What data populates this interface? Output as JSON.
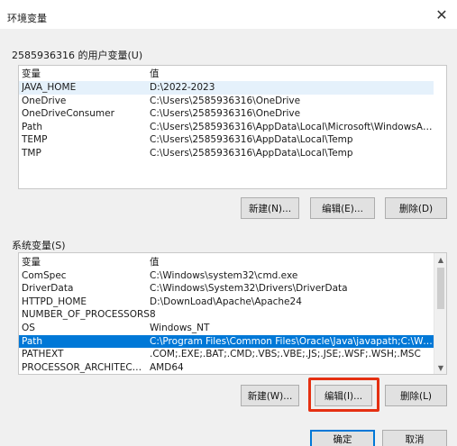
{
  "window": {
    "title": "环境变量",
    "close_glyph": "✕"
  },
  "user_section": {
    "label": "2585936316 的用户变量(U)",
    "columns": [
      "变量",
      "值"
    ],
    "rows": [
      [
        "JAVA_HOME",
        "D:\\2022-2023"
      ],
      [
        "OneDrive",
        "C:\\Users\\2585936316\\OneDrive"
      ],
      [
        "OneDriveConsumer",
        "C:\\Users\\2585936316\\OneDrive"
      ],
      [
        "Path",
        "C:\\Users\\2585936316\\AppData\\Local\\Microsoft\\WindowsApps;..."
      ],
      [
        "TEMP",
        "C:\\Users\\2585936316\\AppData\\Local\\Temp"
      ],
      [
        "TMP",
        "C:\\Users\\2585936316\\AppData\\Local\\Temp"
      ]
    ],
    "buttons": {
      "new": "新建(N)...",
      "edit": "编辑(E)...",
      "delete": "删除(D)"
    }
  },
  "system_section": {
    "label": "系统变量(S)",
    "columns": [
      "变量",
      "值"
    ],
    "rows": [
      [
        "ComSpec",
        "C:\\Windows\\system32\\cmd.exe"
      ],
      [
        "DriverData",
        "C:\\Windows\\System32\\Drivers\\DriverData"
      ],
      [
        "HTTPD_HOME",
        "D:\\DownLoad\\Apache\\Apache24"
      ],
      [
        "NUMBER_OF_PROCESSORS",
        "8"
      ],
      [
        "OS",
        "Windows_NT"
      ],
      [
        "Path",
        "C:\\Program Files\\Common Files\\Oracle\\Java\\javapath;C:\\Windo..."
      ],
      [
        "PATHEXT",
        ".COM;.EXE;.BAT;.CMD;.VBS;.VBE;.JS;.JSE;.WSF;.WSH;.MSC"
      ],
      [
        "PROCESSOR_ARCHITECTU...",
        "AMD64"
      ]
    ],
    "selected_row": 5,
    "buttons": {
      "new": "新建(W)...",
      "edit": "编辑(I)...",
      "delete": "删除(L)"
    }
  },
  "footer": {
    "ok": "确定",
    "cancel": "取消"
  },
  "colors": {
    "selection": "#0078d7",
    "highlight_box": "#e53012"
  }
}
